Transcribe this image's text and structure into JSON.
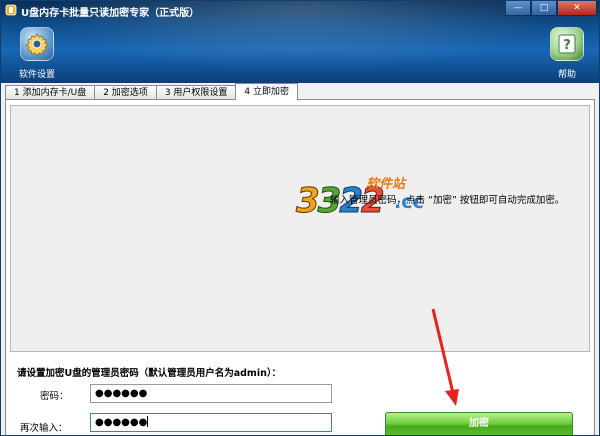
{
  "window": {
    "title": "U盘内存卡批量只读加密专家（正式版）",
    "controls": {
      "minimize": "—",
      "maximize": "□",
      "close": "✕"
    }
  },
  "toolbar": {
    "settings_label": "软件设置",
    "settings_icon": "gear-icon",
    "help_label": "帮助",
    "help_icon": "help-icon"
  },
  "tabs": [
    {
      "label": "1 添加内存卡/U盘",
      "active": false
    },
    {
      "label": "2 加密选项",
      "active": false
    },
    {
      "label": "3 用户权限设置",
      "active": false
    },
    {
      "label": "4 立即加密",
      "active": true
    }
  ],
  "watermark": {
    "part1": "3",
    "part2": "3",
    "part3": "2",
    "part4": "2",
    "suffix": ".cc",
    "site": "软件站"
  },
  "hint_text": "输入管理员密码，点击 “加密” 按钮即可自动完成加密。",
  "form": {
    "prompt": "请设置加密U盘的管理员密码（默认管理员用户名为admin）：",
    "password_label": "密码：",
    "password_value": "●●●●●●",
    "confirm_label": "再次输入：",
    "confirm_value": "●●●●●●",
    "encrypt_button": "加密"
  },
  "colors": {
    "titlebar": "#0f4e8c",
    "encrypt_button": "#5dbf2e",
    "arrow": "#e8231d"
  }
}
